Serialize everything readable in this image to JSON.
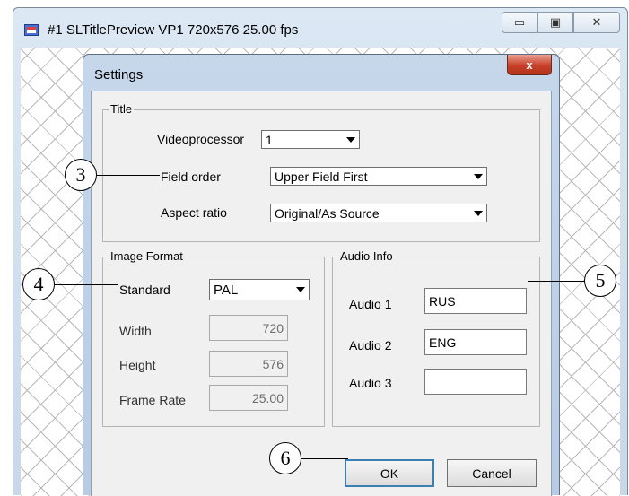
{
  "outer_window": {
    "title": "#1 SLTitlePreview VP1 720x576 25.00 fps",
    "buttons": {
      "minimize": "▭",
      "maximize": "▣",
      "close": "✕"
    }
  },
  "dialog": {
    "title": "Settings",
    "close_label": "x",
    "title_group": {
      "label": "Title",
      "videoprocessor_label": "Videoprocessor",
      "videoprocessor_value": "1",
      "field_order_label": "Field order",
      "field_order_value": "Upper Field First",
      "aspect_ratio_label": "Aspect ratio",
      "aspect_ratio_value": "Original/As Source"
    },
    "image_format": {
      "label": "Image Format",
      "standard_label": "Standard",
      "standard_value": "PAL",
      "width_label": "Width",
      "width_value": "720",
      "height_label": "Height",
      "height_value": "576",
      "frame_rate_label": "Frame Rate",
      "frame_rate_value": "25.00"
    },
    "audio_info": {
      "label": "Audio Info",
      "audio1_label": "Audio 1",
      "audio1_value": "RUS",
      "audio2_label": "Audio 2",
      "audio2_value": "ENG",
      "audio3_label": "Audio 3",
      "audio3_value": ""
    },
    "ok_label": "OK",
    "cancel_label": "Cancel"
  },
  "callouts": {
    "c3": "3",
    "c4": "4",
    "c5": "5",
    "c6": "6"
  }
}
